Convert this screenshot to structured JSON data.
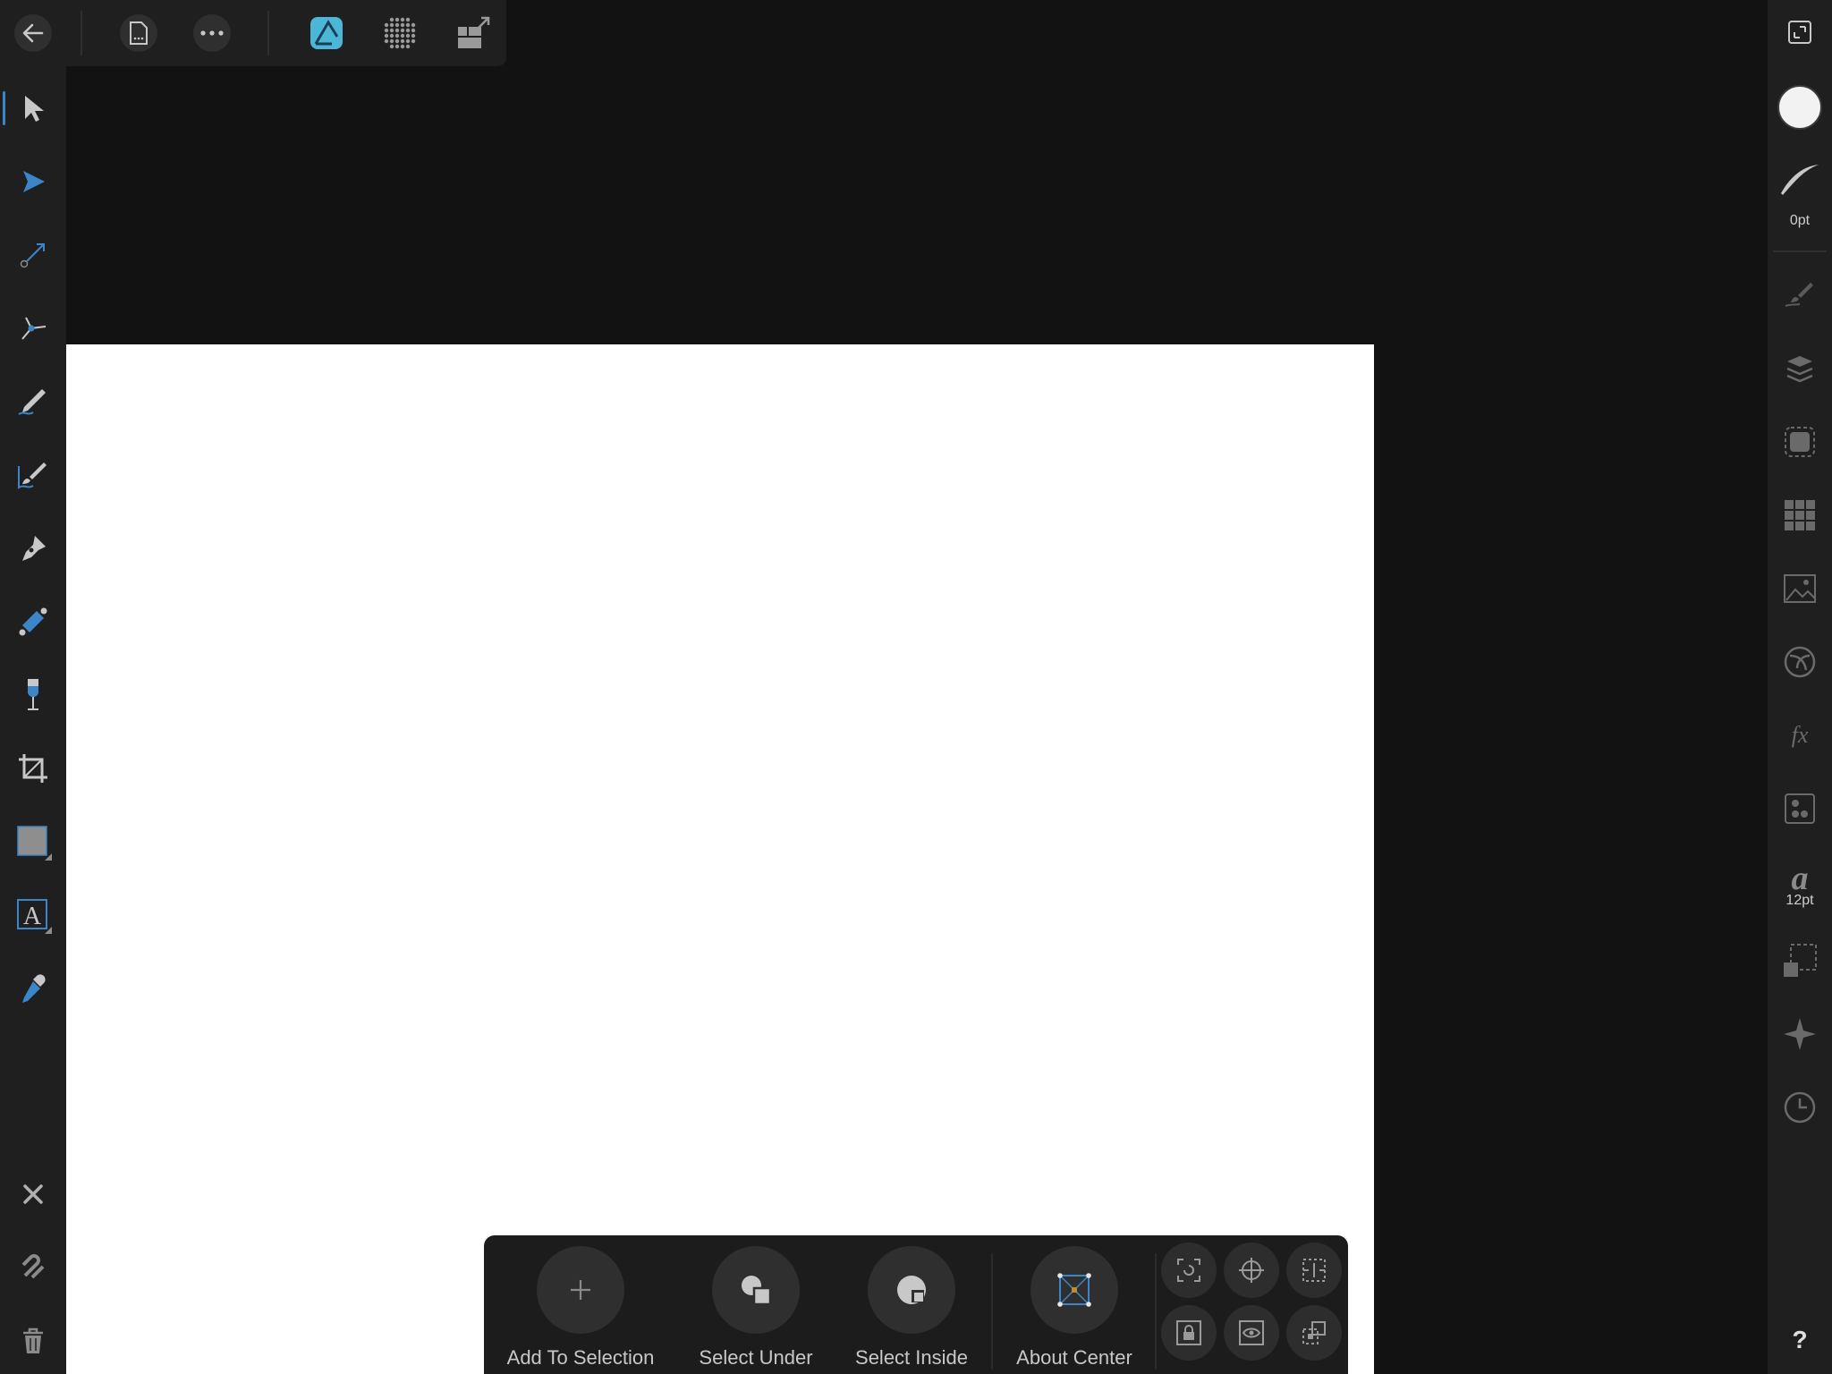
{
  "top_toolbar": {
    "buttons": [
      {
        "name": "back",
        "icon": "arrow-left-icon"
      },
      {
        "name": "document-menu",
        "icon": "document-icon"
      },
      {
        "name": "more",
        "icon": "ellipsis-icon"
      },
      {
        "name": "designer-persona",
        "icon": "designer-persona-icon",
        "active": true
      },
      {
        "name": "pixel-persona",
        "icon": "pixel-persona-icon"
      },
      {
        "name": "export-persona",
        "icon": "export-persona-icon"
      }
    ]
  },
  "left_tools": [
    {
      "name": "move-tool",
      "icon": "move-arrow-icon",
      "active": true
    },
    {
      "name": "node-tool",
      "icon": "node-arrow-icon"
    },
    {
      "name": "corner-tool",
      "icon": "corner-tool-icon"
    },
    {
      "name": "point-transform-tool",
      "icon": "point-transform-icon"
    },
    {
      "name": "pencil-tool",
      "icon": "pencil-icon"
    },
    {
      "name": "vector-brush-tool",
      "icon": "vector-brush-icon"
    },
    {
      "name": "pen-tool",
      "icon": "pen-nib-icon"
    },
    {
      "name": "fill-tool",
      "icon": "fill-tool-icon"
    },
    {
      "name": "transparency-tool",
      "icon": "transparency-icon"
    },
    {
      "name": "crop-tool",
      "icon": "crop-icon"
    },
    {
      "name": "rectangle-tool",
      "icon": "rectangle-icon"
    },
    {
      "name": "text-tool",
      "icon": "text-frame-icon"
    },
    {
      "name": "color-picker-tool",
      "icon": "eyedropper-icon"
    }
  ],
  "left_bottom": [
    {
      "name": "close",
      "icon": "close-icon"
    },
    {
      "name": "snapping",
      "icon": "magnet-icon"
    },
    {
      "name": "delete",
      "icon": "trash-icon"
    }
  ],
  "right_studio": {
    "stroke_width": "0pt",
    "font_size": "12pt",
    "help": "?",
    "panels": [
      "fullscreen-icon",
      "fill-color-icon",
      "stroke-icon",
      "brushes-icon",
      "layers-icon",
      "selection-icon",
      "swatches-icon",
      "image-icon",
      "appearance-icon",
      "fx-icon",
      "styles-icon",
      "text-icon",
      "transform-icon",
      "navigator-icon",
      "history-icon",
      "help-icon"
    ]
  },
  "context_toolbar": {
    "add_to_selection": "Add To Selection",
    "select_under": "Select Under",
    "select_inside": "Select Inside",
    "about_center": "About Center"
  },
  "colors": {
    "accent": "#3a86c8",
    "persona_teal": "#4bb6d6",
    "ui_bg": "#1f1f1f",
    "canvas_bg": "#121212",
    "page": "#ffffff"
  }
}
